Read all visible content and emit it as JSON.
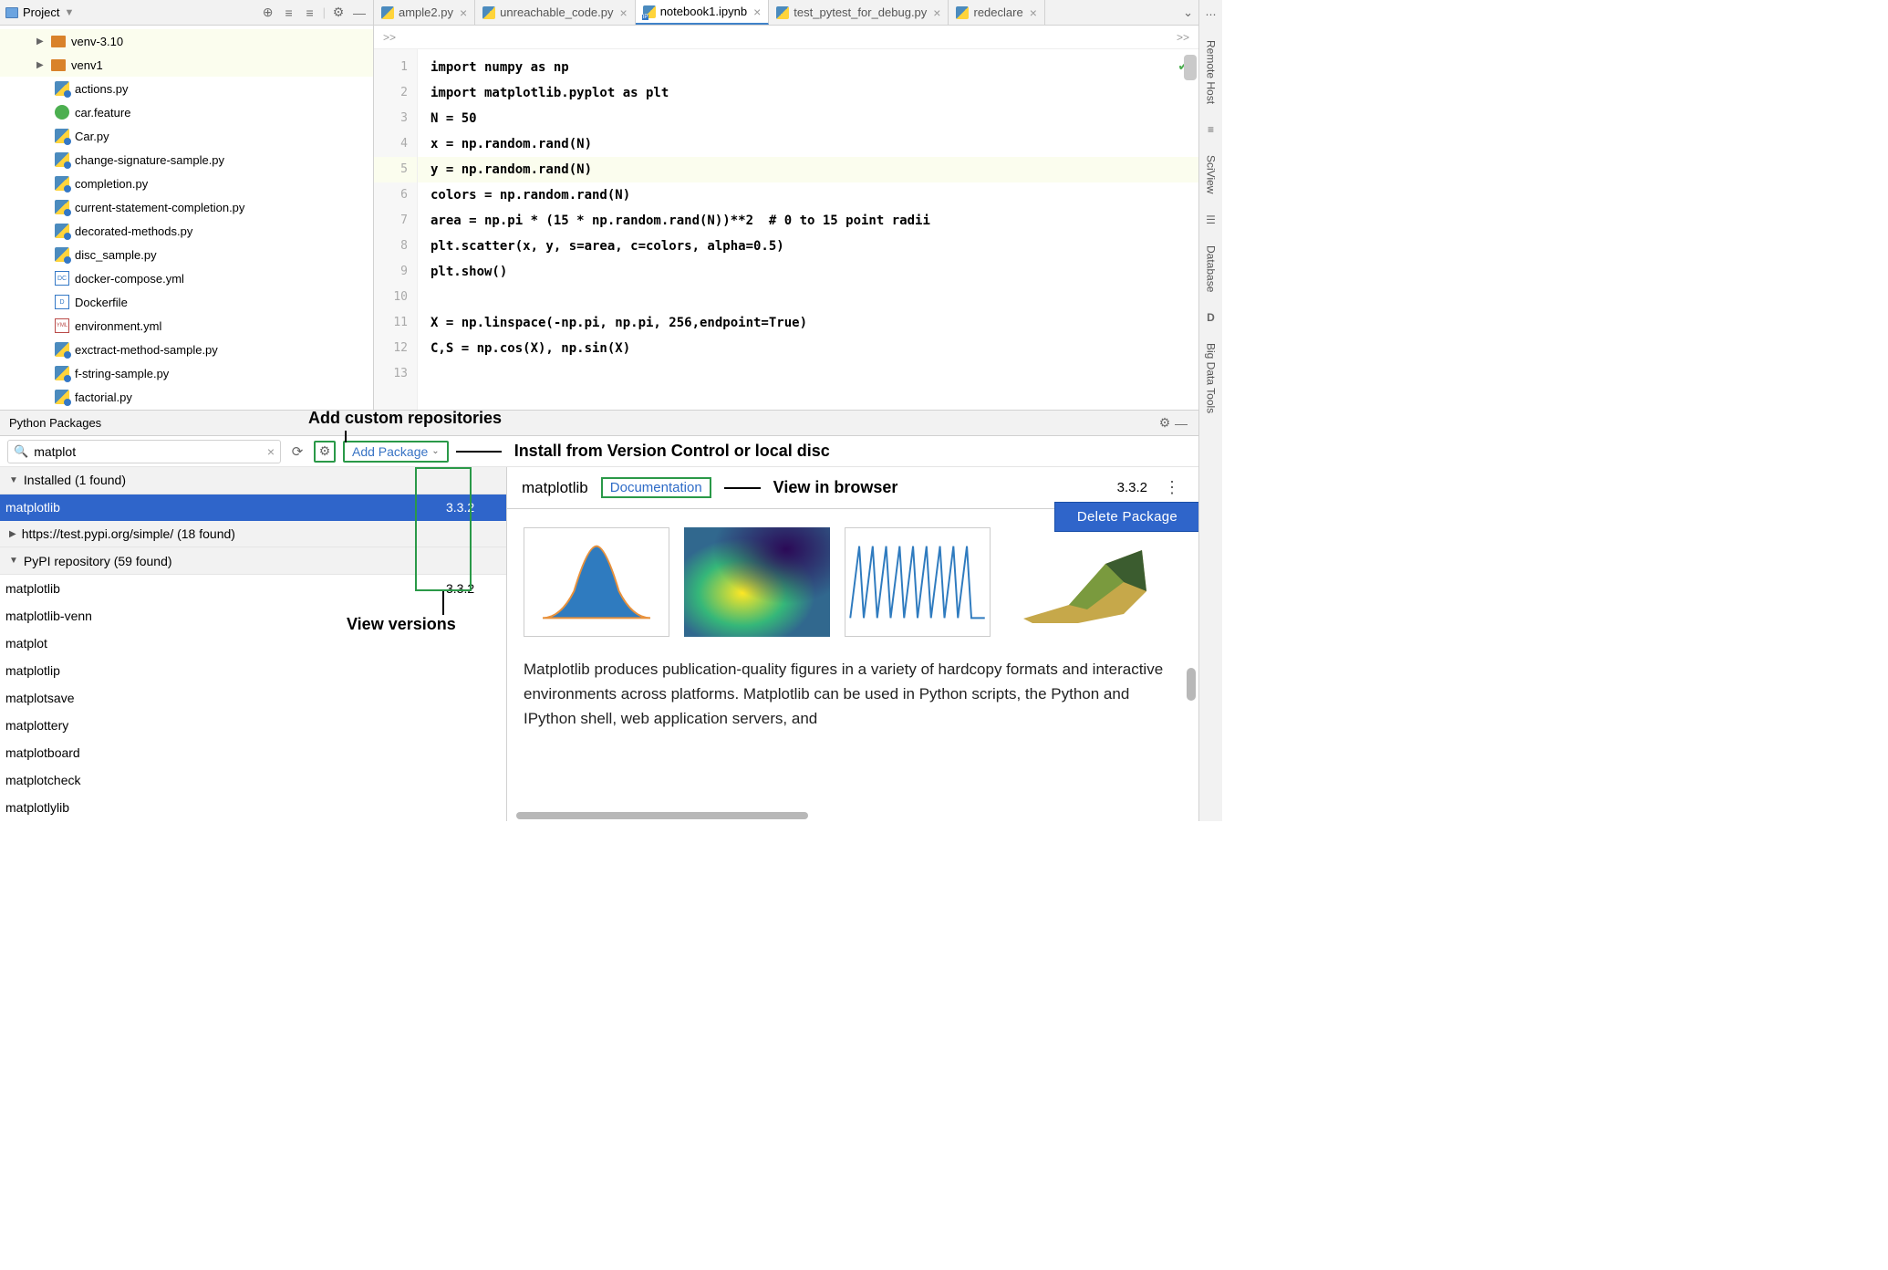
{
  "project_panel": {
    "title": "Project",
    "tree": {
      "folders": [
        {
          "name": "venv-3.10"
        },
        {
          "name": "venv1"
        }
      ],
      "files": [
        {
          "name": "actions.py",
          "icon": "py"
        },
        {
          "name": "car.feature",
          "icon": "feature"
        },
        {
          "name": "Car.py",
          "icon": "py"
        },
        {
          "name": "change-signature-sample.py",
          "icon": "py"
        },
        {
          "name": "completion.py",
          "icon": "py"
        },
        {
          "name": "current-statement-completion.py",
          "icon": "py"
        },
        {
          "name": "decorated-methods.py",
          "icon": "py"
        },
        {
          "name": "disc_sample.py",
          "icon": "py"
        },
        {
          "name": "docker-compose.yml",
          "icon": "dcompose"
        },
        {
          "name": "Dockerfile",
          "icon": "dockerfile"
        },
        {
          "name": "environment.yml",
          "icon": "yml"
        },
        {
          "name": "exctract-method-sample.py",
          "icon": "py"
        },
        {
          "name": "f-string-sample.py",
          "icon": "py"
        },
        {
          "name": "factorial.py",
          "icon": "py"
        }
      ]
    }
  },
  "tabs": [
    {
      "label": "ample2.py",
      "icon": "py",
      "active": false
    },
    {
      "label": "unreachable_code.py",
      "icon": "py",
      "active": false
    },
    {
      "label": "notebook1.ipynb",
      "icon": "ipynb",
      "active": true
    },
    {
      "label": "test_pytest_for_debug.py",
      "icon": "py",
      "active": false
    },
    {
      "label": "redeclare",
      "icon": "py",
      "active": false
    }
  ],
  "breadcrumb": {
    "left": ">>",
    "right": ">>"
  },
  "code": {
    "lines": [
      "import numpy as np",
      "import matplotlib.pyplot as plt",
      "N = 50",
      "x = np.random.rand(N)",
      "y = np.random.rand(N)",
      "colors = np.random.rand(N)",
      "area = np.pi * (15 * np.random.rand(N))**2  # 0 to 15 point radii",
      "plt.scatter(x, y, s=area, c=colors, alpha=0.5)",
      "plt.show()",
      "",
      "X = np.linspace(-np.pi, np.pi, 256,endpoint=True)",
      "C,S = np.cos(X), np.sin(X)",
      ""
    ],
    "highlighted_line_index": 4
  },
  "right_sidebar": [
    "Remote Host",
    "SciView",
    "Database",
    "Big Data Tools"
  ],
  "packages": {
    "panel_title": "Python Packages",
    "search_value": "matplot",
    "add_package_label": "Add Package",
    "groups": {
      "installed": {
        "label": "Installed (1 found)",
        "items": [
          {
            "name": "matplotlib",
            "version": "3.3.2",
            "selected": true
          }
        ]
      },
      "custom_repo": {
        "label": "https://test.pypi.org/simple/ (18 found)"
      },
      "pypi": {
        "label": "PyPI repository (59 found)",
        "items": [
          {
            "name": "matplotlib",
            "version": "3.3.2"
          },
          {
            "name": "matplotlib-venn"
          },
          {
            "name": "matplot"
          },
          {
            "name": "matplotlip"
          },
          {
            "name": "matplotsave"
          },
          {
            "name": "matplottery"
          },
          {
            "name": "matplotboard"
          },
          {
            "name": "matplotcheck"
          },
          {
            "name": "matplotlylib"
          }
        ]
      }
    },
    "detail": {
      "name": "matplotlib",
      "doc_link": "Documentation",
      "version": "3.3.2",
      "delete_label": "Delete Package",
      "description": "Matplotlib produces publication-quality figures in a variety of hardcopy formats and interactive environments across platforms. Matplotlib can be used in Python scripts, the Python and IPython shell, web application servers, and"
    }
  },
  "annotations": {
    "add_repos": "Add custom repositories",
    "install_from": "Install from Version Control or local disc",
    "view_browser": "View in browser",
    "view_versions": "View versions"
  }
}
